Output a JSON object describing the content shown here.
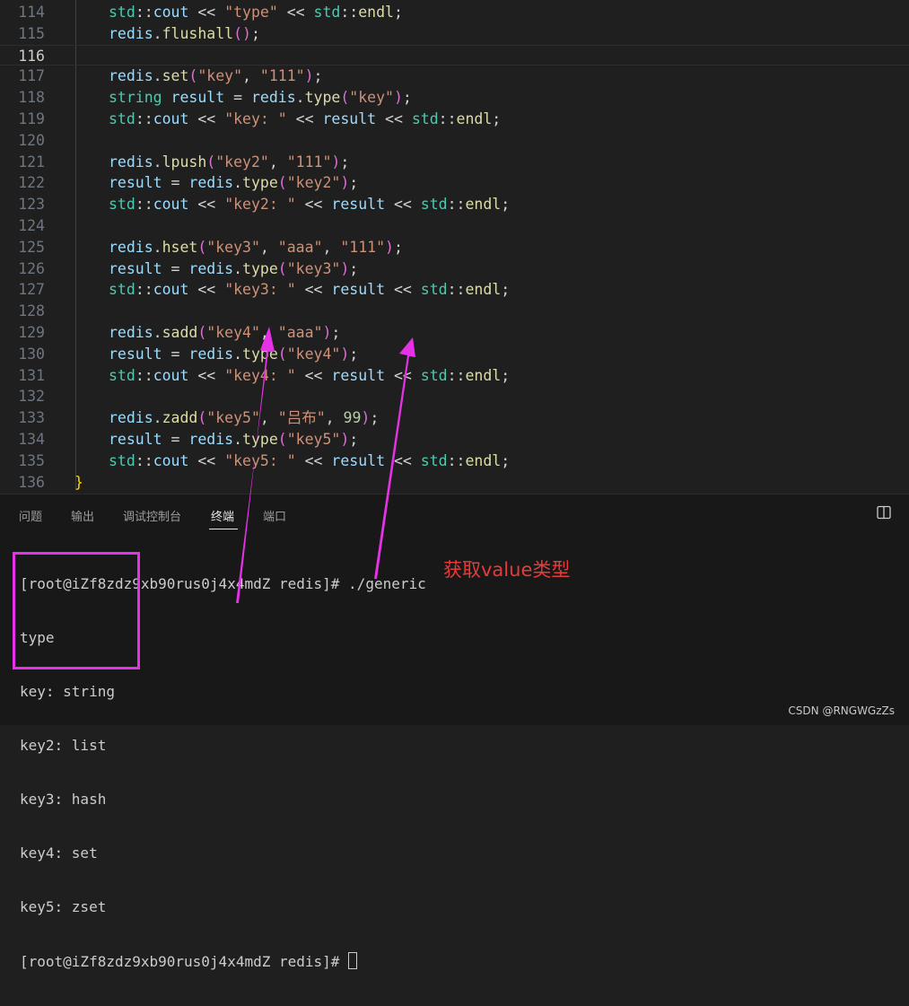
{
  "editor": {
    "lines": [
      {
        "num": "114",
        "tokens": [
          [
            "tok-ns",
            "std"
          ],
          [
            "tok-op",
            "::"
          ],
          [
            "tok-id",
            "cout"
          ],
          [
            "tok-op",
            " << "
          ],
          [
            "tok-str",
            "\"type\""
          ],
          [
            "tok-op",
            " << "
          ],
          [
            "tok-ns",
            "std"
          ],
          [
            "tok-op",
            "::"
          ],
          [
            "tok-fn",
            "endl"
          ],
          [
            "tok-op",
            ";"
          ]
        ]
      },
      {
        "num": "115",
        "tokens": [
          [
            "tok-id",
            "redis"
          ],
          [
            "tok-op",
            "."
          ],
          [
            "tok-fn",
            "flushall"
          ],
          [
            "tok-b1",
            "()"
          ],
          [
            "tok-op",
            ";"
          ]
        ]
      },
      {
        "num": "116",
        "current": true,
        "tokens": []
      },
      {
        "num": "117",
        "tokens": [
          [
            "tok-id",
            "redis"
          ],
          [
            "tok-op",
            "."
          ],
          [
            "tok-fn",
            "set"
          ],
          [
            "tok-b1",
            "("
          ],
          [
            "tok-str",
            "\"key\""
          ],
          [
            "tok-op",
            ", "
          ],
          [
            "tok-str",
            "\"111\""
          ],
          [
            "tok-b1",
            ")"
          ],
          [
            "tok-op",
            ";"
          ]
        ]
      },
      {
        "num": "118",
        "tokens": [
          [
            "tok-ns",
            "string"
          ],
          [
            "tok-op",
            " "
          ],
          [
            "tok-id",
            "result"
          ],
          [
            "tok-op",
            " = "
          ],
          [
            "tok-id",
            "redis"
          ],
          [
            "tok-op",
            "."
          ],
          [
            "tok-fn",
            "type"
          ],
          [
            "tok-b1",
            "("
          ],
          [
            "tok-str",
            "\"key\""
          ],
          [
            "tok-b1",
            ")"
          ],
          [
            "tok-op",
            ";"
          ]
        ]
      },
      {
        "num": "119",
        "tokens": [
          [
            "tok-ns",
            "std"
          ],
          [
            "tok-op",
            "::"
          ],
          [
            "tok-id",
            "cout"
          ],
          [
            "tok-op",
            " << "
          ],
          [
            "tok-str",
            "\"key: \""
          ],
          [
            "tok-op",
            " << "
          ],
          [
            "tok-id",
            "result"
          ],
          [
            "tok-op",
            " << "
          ],
          [
            "tok-ns",
            "std"
          ],
          [
            "tok-op",
            "::"
          ],
          [
            "tok-fn",
            "endl"
          ],
          [
            "tok-op",
            ";"
          ]
        ]
      },
      {
        "num": "120",
        "tokens": []
      },
      {
        "num": "121",
        "tokens": [
          [
            "tok-id",
            "redis"
          ],
          [
            "tok-op",
            "."
          ],
          [
            "tok-fn",
            "lpush"
          ],
          [
            "tok-b1",
            "("
          ],
          [
            "tok-str",
            "\"key2\""
          ],
          [
            "tok-op",
            ", "
          ],
          [
            "tok-str",
            "\"111\""
          ],
          [
            "tok-b1",
            ")"
          ],
          [
            "tok-op",
            ";"
          ]
        ]
      },
      {
        "num": "122",
        "tokens": [
          [
            "tok-id",
            "result"
          ],
          [
            "tok-op",
            " = "
          ],
          [
            "tok-id",
            "redis"
          ],
          [
            "tok-op",
            "."
          ],
          [
            "tok-fn",
            "type"
          ],
          [
            "tok-b1",
            "("
          ],
          [
            "tok-str",
            "\"key2\""
          ],
          [
            "tok-b1",
            ")"
          ],
          [
            "tok-op",
            ";"
          ]
        ]
      },
      {
        "num": "123",
        "tokens": [
          [
            "tok-ns",
            "std"
          ],
          [
            "tok-op",
            "::"
          ],
          [
            "tok-id",
            "cout"
          ],
          [
            "tok-op",
            " << "
          ],
          [
            "tok-str",
            "\"key2: \""
          ],
          [
            "tok-op",
            " << "
          ],
          [
            "tok-id",
            "result"
          ],
          [
            "tok-op",
            " << "
          ],
          [
            "tok-ns",
            "std"
          ],
          [
            "tok-op",
            "::"
          ],
          [
            "tok-fn",
            "endl"
          ],
          [
            "tok-op",
            ";"
          ]
        ]
      },
      {
        "num": "124",
        "tokens": []
      },
      {
        "num": "125",
        "tokens": [
          [
            "tok-id",
            "redis"
          ],
          [
            "tok-op",
            "."
          ],
          [
            "tok-fn",
            "hset"
          ],
          [
            "tok-b1",
            "("
          ],
          [
            "tok-str",
            "\"key3\""
          ],
          [
            "tok-op",
            ", "
          ],
          [
            "tok-str",
            "\"aaa\""
          ],
          [
            "tok-op",
            ", "
          ],
          [
            "tok-str",
            "\"111\""
          ],
          [
            "tok-b1",
            ")"
          ],
          [
            "tok-op",
            ";"
          ]
        ]
      },
      {
        "num": "126",
        "tokens": [
          [
            "tok-id",
            "result"
          ],
          [
            "tok-op",
            " = "
          ],
          [
            "tok-id",
            "redis"
          ],
          [
            "tok-op",
            "."
          ],
          [
            "tok-fn",
            "type"
          ],
          [
            "tok-b1",
            "("
          ],
          [
            "tok-str",
            "\"key3\""
          ],
          [
            "tok-b1",
            ")"
          ],
          [
            "tok-op",
            ";"
          ]
        ]
      },
      {
        "num": "127",
        "tokens": [
          [
            "tok-ns",
            "std"
          ],
          [
            "tok-op",
            "::"
          ],
          [
            "tok-id",
            "cout"
          ],
          [
            "tok-op",
            " << "
          ],
          [
            "tok-str",
            "\"key3: \""
          ],
          [
            "tok-op",
            " << "
          ],
          [
            "tok-id",
            "result"
          ],
          [
            "tok-op",
            " << "
          ],
          [
            "tok-ns",
            "std"
          ],
          [
            "tok-op",
            "::"
          ],
          [
            "tok-fn",
            "endl"
          ],
          [
            "tok-op",
            ";"
          ]
        ]
      },
      {
        "num": "128",
        "tokens": []
      },
      {
        "num": "129",
        "tokens": [
          [
            "tok-id",
            "redis"
          ],
          [
            "tok-op",
            "."
          ],
          [
            "tok-fn",
            "sadd"
          ],
          [
            "tok-b1",
            "("
          ],
          [
            "tok-str",
            "\"key4\""
          ],
          [
            "tok-op",
            ", "
          ],
          [
            "tok-str",
            "\"aaa\""
          ],
          [
            "tok-b1",
            ")"
          ],
          [
            "tok-op",
            ";"
          ]
        ]
      },
      {
        "num": "130",
        "tokens": [
          [
            "tok-id",
            "result"
          ],
          [
            "tok-op",
            " = "
          ],
          [
            "tok-id",
            "redis"
          ],
          [
            "tok-op",
            "."
          ],
          [
            "tok-fn",
            "type"
          ],
          [
            "tok-b1",
            "("
          ],
          [
            "tok-str",
            "\"key4\""
          ],
          [
            "tok-b1",
            ")"
          ],
          [
            "tok-op",
            ";"
          ]
        ]
      },
      {
        "num": "131",
        "tokens": [
          [
            "tok-ns",
            "std"
          ],
          [
            "tok-op",
            "::"
          ],
          [
            "tok-id",
            "cout"
          ],
          [
            "tok-op",
            " << "
          ],
          [
            "tok-str",
            "\"key4: \""
          ],
          [
            "tok-op",
            " << "
          ],
          [
            "tok-id",
            "result"
          ],
          [
            "tok-op",
            " << "
          ],
          [
            "tok-ns",
            "std"
          ],
          [
            "tok-op",
            "::"
          ],
          [
            "tok-fn",
            "endl"
          ],
          [
            "tok-op",
            ";"
          ]
        ]
      },
      {
        "num": "132",
        "tokens": []
      },
      {
        "num": "133",
        "tokens": [
          [
            "tok-id",
            "redis"
          ],
          [
            "tok-op",
            "."
          ],
          [
            "tok-fn",
            "zadd"
          ],
          [
            "tok-b1",
            "("
          ],
          [
            "tok-str",
            "\"key5\""
          ],
          [
            "tok-op",
            ", "
          ],
          [
            "tok-str",
            "\"吕布\""
          ],
          [
            "tok-op",
            ", "
          ],
          [
            "tok-num",
            "99"
          ],
          [
            "tok-b1",
            ")"
          ],
          [
            "tok-op",
            ";"
          ]
        ]
      },
      {
        "num": "134",
        "tokens": [
          [
            "tok-id",
            "result"
          ],
          [
            "tok-op",
            " = "
          ],
          [
            "tok-id",
            "redis"
          ],
          [
            "tok-op",
            "."
          ],
          [
            "tok-fn",
            "type"
          ],
          [
            "tok-b1",
            "("
          ],
          [
            "tok-str",
            "\"key5\""
          ],
          [
            "tok-b1",
            ")"
          ],
          [
            "tok-op",
            ";"
          ]
        ]
      },
      {
        "num": "135",
        "tokens": [
          [
            "tok-ns",
            "std"
          ],
          [
            "tok-op",
            "::"
          ],
          [
            "tok-id",
            "cout"
          ],
          [
            "tok-op",
            " << "
          ],
          [
            "tok-str",
            "\"key5: \""
          ],
          [
            "tok-op",
            " << "
          ],
          [
            "tok-id",
            "result"
          ],
          [
            "tok-op",
            " << "
          ],
          [
            "tok-ns",
            "std"
          ],
          [
            "tok-op",
            "::"
          ],
          [
            "tok-fn",
            "endl"
          ],
          [
            "tok-op",
            ";"
          ]
        ]
      },
      {
        "num": "136",
        "outdent": true,
        "tokens": [
          [
            "tok-b0",
            "}"
          ]
        ]
      }
    ]
  },
  "panel": {
    "tabs": [
      {
        "label": "问题",
        "active": false
      },
      {
        "label": "输出",
        "active": false
      },
      {
        "label": "调试控制台",
        "active": false
      },
      {
        "label": "终端",
        "active": true
      },
      {
        "label": "端口",
        "active": false
      }
    ],
    "split_icon": "split-editor-icon"
  },
  "terminal": {
    "command_line": "[root@iZf8zdz9xb90rus0j4x4mdZ redis]# ./generic",
    "output": [
      "type",
      "key: string",
      "key2: list",
      "key3: hash",
      "key4: set",
      "key5: zset"
    ],
    "prompt": "[root@iZf8zdz9xb90rus0j4x4mdZ redis]# "
  },
  "annotation": {
    "label": "获取value类型",
    "color": "#e632e6",
    "label_color": "#e63b3b"
  },
  "watermark": "CSDN @RNGWGzZs"
}
